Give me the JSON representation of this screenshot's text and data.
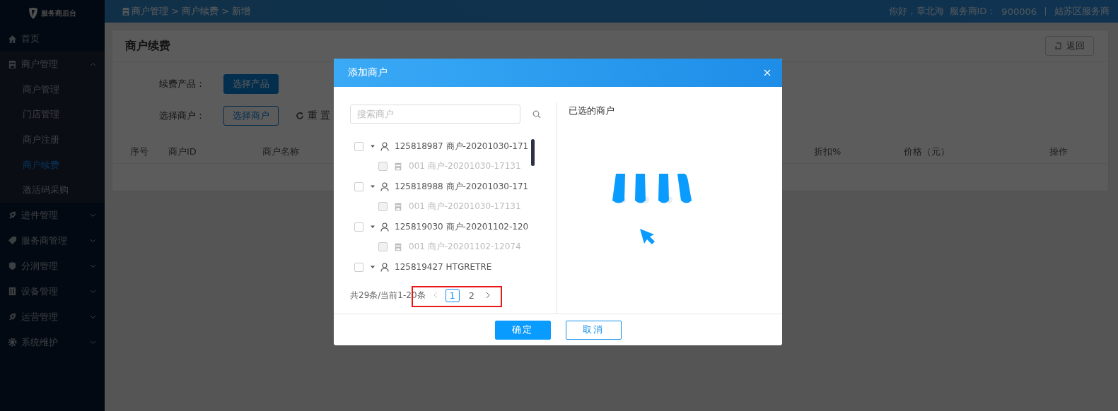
{
  "sidebar": {
    "logo_text": "服务商后台",
    "items": [
      {
        "label": "首页"
      },
      {
        "label": "商户管理",
        "expanded": true,
        "children": [
          {
            "label": "商户管理",
            "selected": false
          },
          {
            "label": "门店管理",
            "selected": false
          },
          {
            "label": "商户注册",
            "selected": false
          },
          {
            "label": "商户续费",
            "selected": true
          },
          {
            "label": "激活码采购",
            "selected": false
          }
        ]
      },
      {
        "label": "进件管理",
        "expanded": false
      },
      {
        "label": "服务商管理",
        "expanded": false
      },
      {
        "label": "分润管理",
        "expanded": false
      },
      {
        "label": "设备管理",
        "expanded": false
      },
      {
        "label": "运营管理",
        "expanded": false
      },
      {
        "label": "系统维护",
        "expanded": false
      }
    ]
  },
  "header": {
    "breadcrumb": "商户管理 > 商户续费 > 新增",
    "greeting": "你好，章北海",
    "provider_id_label": "服务商ID：",
    "provider_id": "900006",
    "region": "姑苏区服务商"
  },
  "page": {
    "title": "商户续费",
    "back_button": "返回",
    "form": [
      {
        "label": "续费产品：",
        "button": "选择产品",
        "kind": "primary"
      },
      {
        "label": "选择商户：",
        "button": "选择商户",
        "kind": "outline",
        "reset_button": "重 置"
      }
    ],
    "table": {
      "columns": [
        {
          "label": "序号"
        },
        {
          "label": "商户ID"
        },
        {
          "label": "商户名称"
        },
        {
          "label": "折扣%"
        },
        {
          "label": "价格（元）"
        },
        {
          "label": "操作"
        }
      ]
    }
  },
  "dialog": {
    "title": "添加商户",
    "search": {
      "placeholder": "搜索商户"
    },
    "tree": [
      {
        "label": "125818987 商户-20201030-171",
        "checked": false,
        "expanded": true,
        "children": [
          {
            "label": "001 商户-20201030-17131",
            "checked": false,
            "disabled": true
          }
        ]
      },
      {
        "label": "125818988 商户-20201030-171",
        "checked": false,
        "expanded": true,
        "children": [
          {
            "label": "001 商户-20201030-17131",
            "checked": false,
            "disabled": true
          }
        ]
      },
      {
        "label": "125819030 商户-20201102-120",
        "checked": false,
        "expanded": true,
        "children": [
          {
            "label": "001 商户-20201102-12074",
            "checked": false,
            "disabled": true
          }
        ]
      },
      {
        "label": "125819427 HTGRETRE",
        "checked": false,
        "expanded": true
      }
    ],
    "pagination": {
      "summary": "共29条/当前1-20条",
      "prev_disabled": true,
      "pages": [
        {
          "label": "1",
          "selected": true
        },
        {
          "label": "2",
          "selected": false
        }
      ]
    },
    "selected_title": "已选的商户",
    "confirm_button": "确定",
    "cancel_button": "取消"
  }
}
